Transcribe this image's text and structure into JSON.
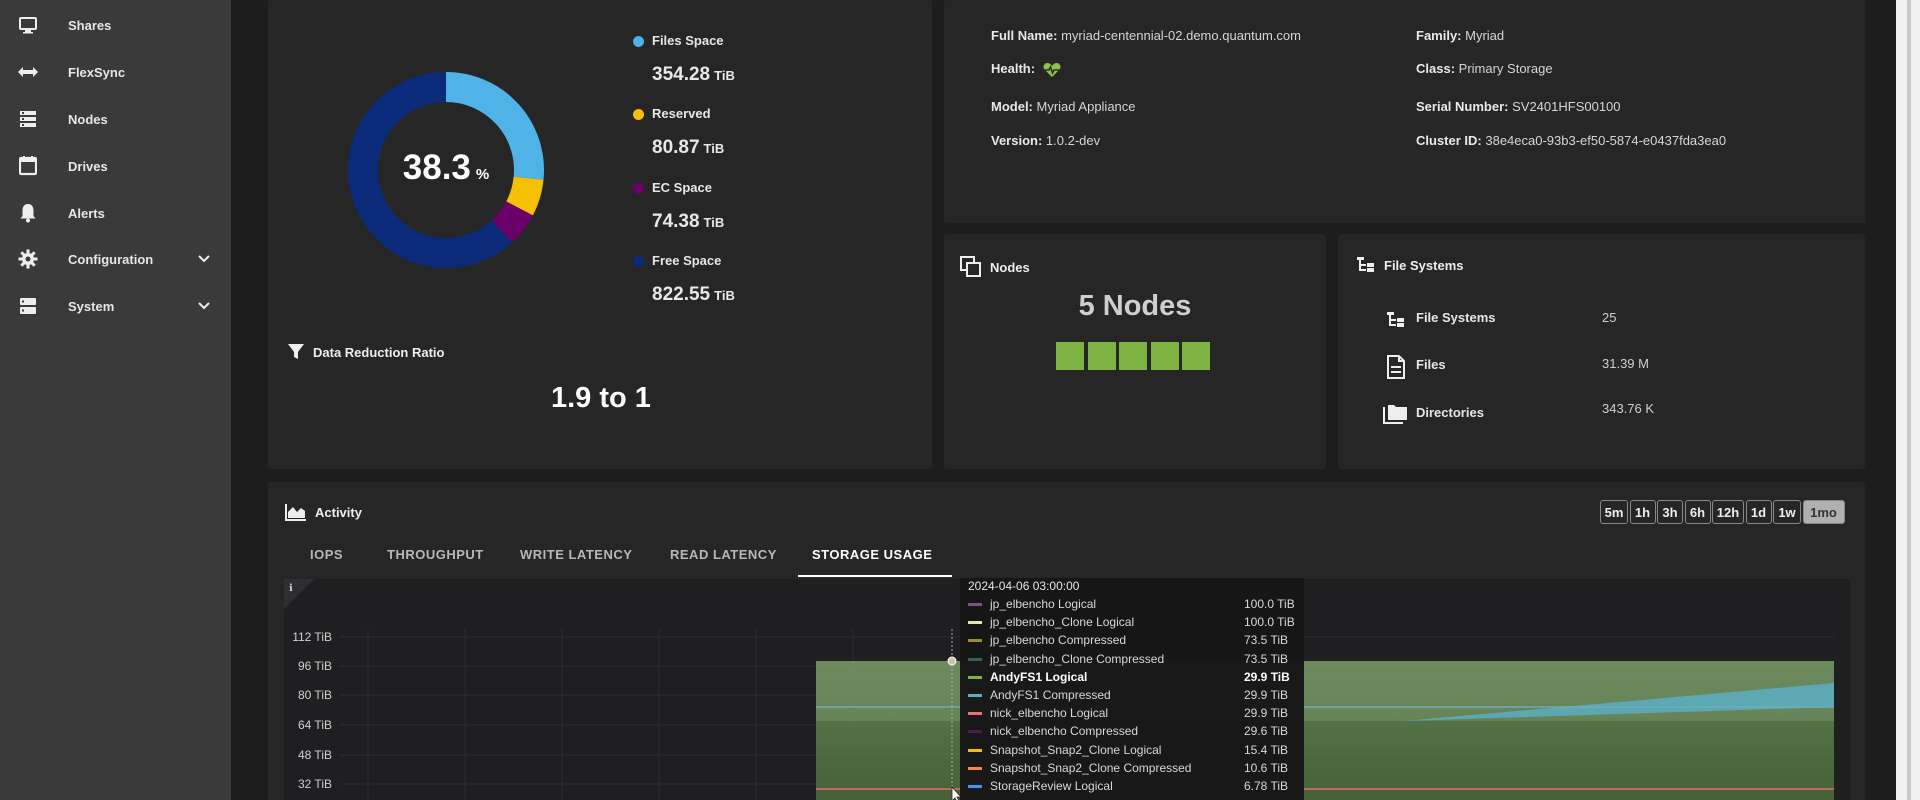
{
  "sidebar": {
    "items": [
      {
        "label": "Shares",
        "icon": "monitor-icon"
      },
      {
        "label": "FlexSync",
        "icon": "arrows-horizontal-icon"
      },
      {
        "label": "Nodes",
        "icon": "server-stack-icon"
      },
      {
        "label": "Drives",
        "icon": "drive-icon"
      },
      {
        "label": "Alerts",
        "icon": "bell-icon"
      },
      {
        "label": "Configuration",
        "icon": "gear-icon"
      },
      {
        "label": "System",
        "icon": "server-icon"
      }
    ]
  },
  "capacity": {
    "percent": "38.3",
    "percent_unit": "%",
    "legend": [
      {
        "name": "Files Space",
        "value": "354.28",
        "unit": "TiB",
        "color": "#4fb3e8"
      },
      {
        "name": "Reserved",
        "value": "80.87",
        "unit": "TiB",
        "color": "#f5c000"
      },
      {
        "name": "EC Space",
        "value": "74.38",
        "unit": "TiB",
        "color": "#6b006b"
      },
      {
        "name": "Free Space",
        "value": "822.55",
        "unit": "TiB",
        "color": "#0b2a7a"
      }
    ]
  },
  "data_reduction": {
    "title": "Data Reduction Ratio",
    "value": "1.9 to 1"
  },
  "cluster_info": {
    "full_name_label": "Full Name:",
    "full_name": "myriad-centennial-02.demo.quantum.com",
    "health_label": "Health:",
    "model_label": "Model:",
    "model": "Myriad Appliance",
    "version_label": "Version:",
    "version": "1.0.2-dev",
    "family_label": "Family:",
    "family": "Myriad",
    "class_label": "Class:",
    "class": "Primary Storage",
    "serial_label": "Serial Number:",
    "serial": "SV2401HFS00100",
    "cluster_id_label": "Cluster ID:",
    "cluster_id": "38e4eca0-93b3-ef50-5874-e0437fda3ea0"
  },
  "nodes_card": {
    "title": "Nodes",
    "count_text": "5 Nodes",
    "node_count": 5,
    "node_color": "#7cb342"
  },
  "filesystems_card": {
    "title": "File Systems",
    "rows": [
      {
        "label": "File Systems",
        "value": "25"
      },
      {
        "label": "Files",
        "value": "31.39 M"
      },
      {
        "label": "Directories",
        "value": "343.76 K"
      }
    ]
  },
  "activity": {
    "title": "Activity",
    "time_ranges": [
      "5m",
      "1h",
      "3h",
      "6h",
      "12h",
      "1d",
      "1w",
      "1mo"
    ],
    "active_range": "1mo",
    "tabs": [
      "IOPS",
      "THROUGHPUT",
      "WRITE LATENCY",
      "READ LATENCY",
      "STORAGE USAGE"
    ],
    "active_tab": "STORAGE USAGE",
    "info_glyph": "ℹ"
  },
  "chart_data": {
    "type": "area",
    "y_ticks": [
      "112 TiB",
      "96 TiB",
      "80 TiB",
      "64 TiB",
      "48 TiB",
      "32 TiB"
    ],
    "tooltip": {
      "timestamp": "2024-04-06 03:00:00",
      "rows": [
        {
          "name": "jp_elbencho Logical",
          "value": "100.0 TiB",
          "color": "#7b4f8f"
        },
        {
          "name": "jp_elbencho_Clone Logical",
          "value": "100.0 TiB",
          "color": "#e6e6b0"
        },
        {
          "name": "jp_elbencho Compressed",
          "value": "73.5 TiB",
          "color": "#9a8a3a"
        },
        {
          "name": "jp_elbencho_Clone Compressed",
          "value": "73.5 TiB",
          "color": "#3f5a5a"
        },
        {
          "name": "AndyFS1 Logical",
          "value": "29.9 TiB",
          "color": "#7cb342",
          "bold": true
        },
        {
          "name": "AndyFS1 Compressed",
          "value": "29.9 TiB",
          "color": "#5ab0c8"
        },
        {
          "name": "nick_elbencho Logical",
          "value": "29.9 TiB",
          "color": "#e57373"
        },
        {
          "name": "nick_elbencho Compressed",
          "value": "29.6 TiB",
          "color": "#4a1f4a"
        },
        {
          "name": "Snapshot_Snap2_Clone Logical",
          "value": "15.4 TiB",
          "color": "#f5c000"
        },
        {
          "name": "Snapshot_Snap2_Clone Compressed",
          "value": "10.6 TiB",
          "color": "#f08a4b"
        },
        {
          "name": "StorageReview Logical",
          "value": "6.78 TiB",
          "color": "#4f8fe8"
        }
      ]
    }
  }
}
